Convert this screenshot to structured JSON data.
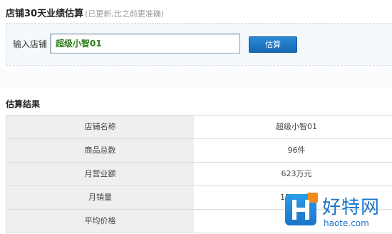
{
  "header": {
    "title": "店铺30天业绩估算",
    "note": "(已更新,比之前更准确)"
  },
  "search": {
    "label": "输入店铺",
    "input_value": "超级小智01",
    "button_label": "估算"
  },
  "result": {
    "title": "估算结果",
    "rows": [
      {
        "label": "店铺名称",
        "value": "超级小智01"
      },
      {
        "label": "商品总数",
        "value": "96件"
      },
      {
        "label": "月营业额",
        "value": "623万元"
      },
      {
        "label": "月销量",
        "value": "15159件"
      },
      {
        "label": "平均价格",
        "value": "407元"
      }
    ]
  },
  "watermark": {
    "text_cn": "好特网",
    "text_en": "haote.com"
  }
}
